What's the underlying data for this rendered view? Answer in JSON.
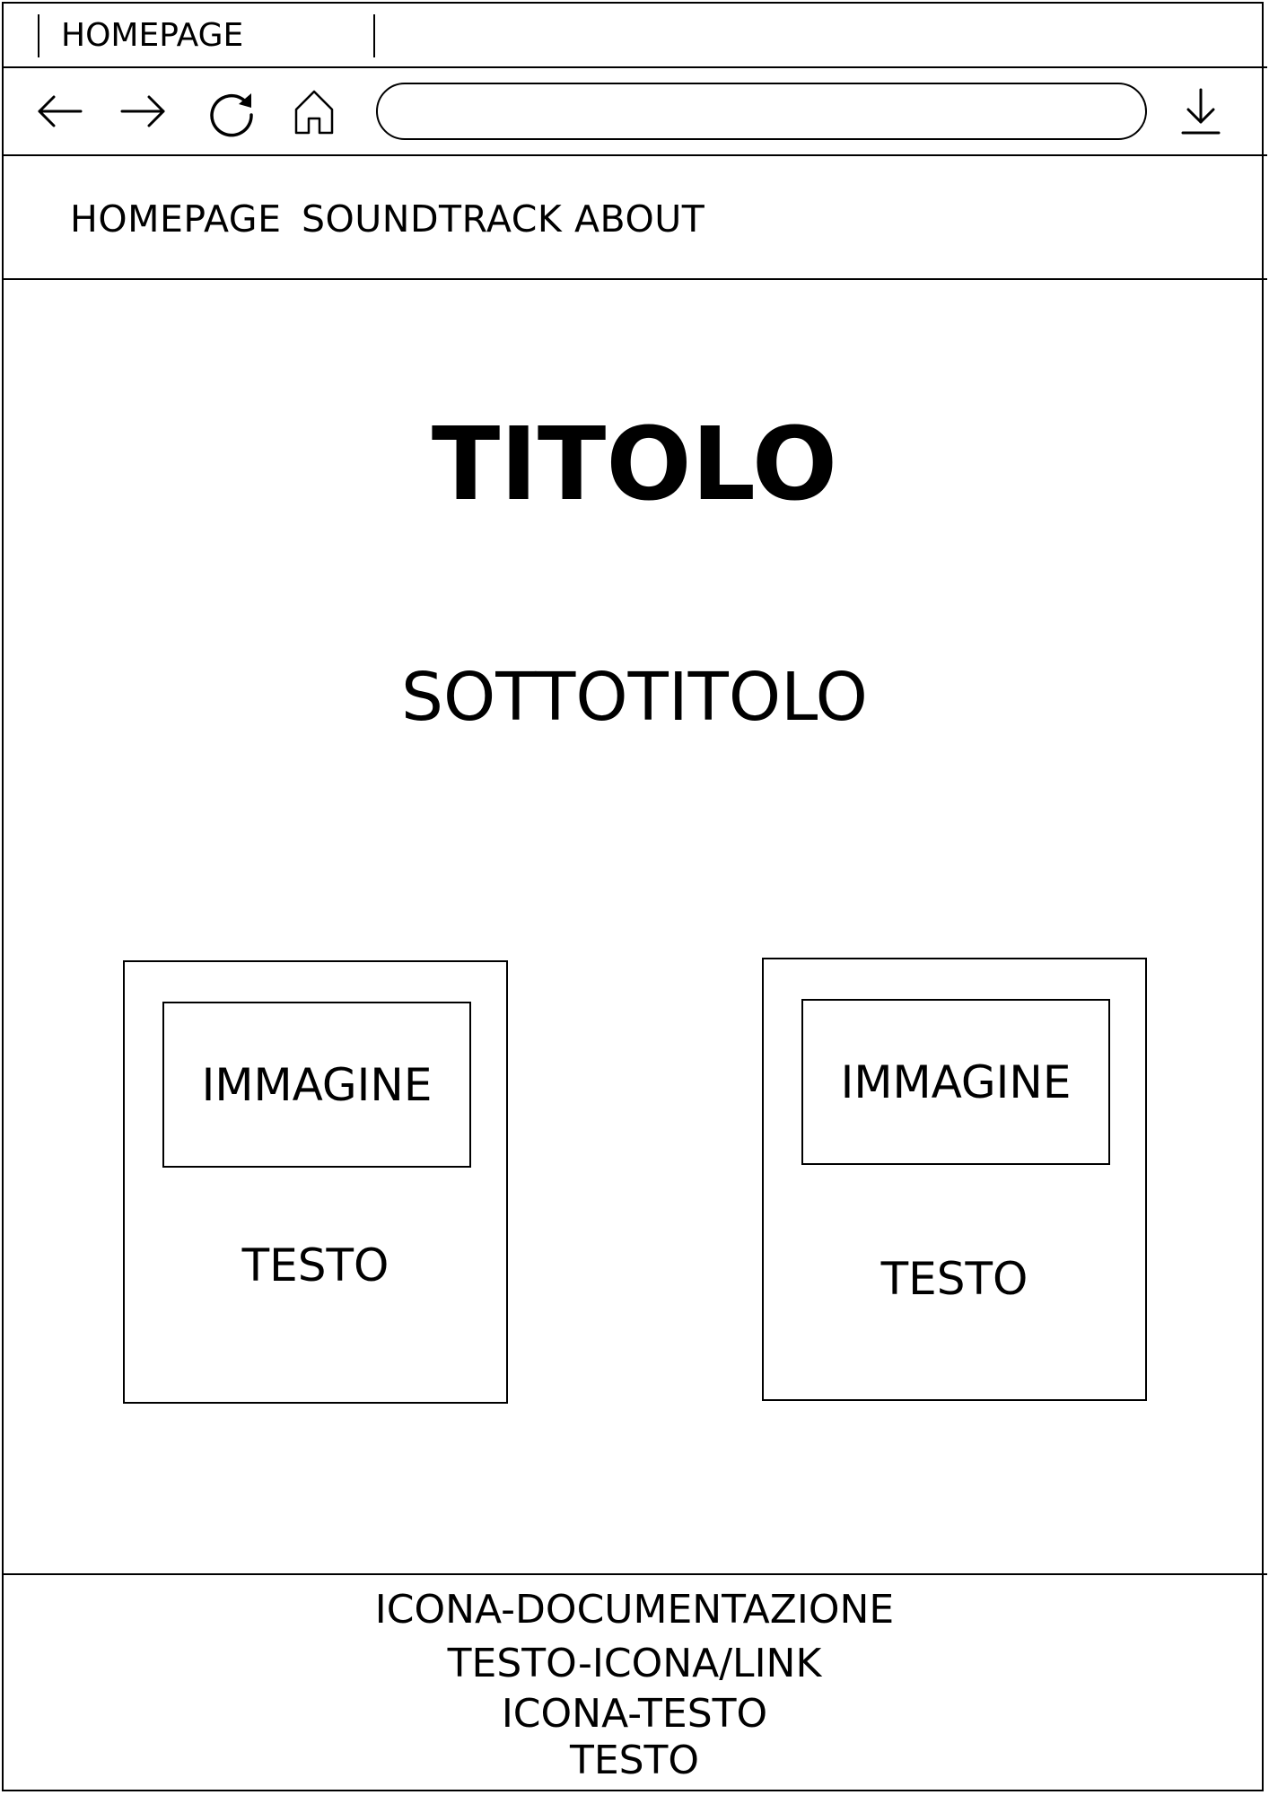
{
  "browser": {
    "tab": {
      "label": "HOMEPAGE"
    },
    "toolbar": {
      "icons": [
        "back-arrow-icon",
        "forward-arrow-icon",
        "reload-icon",
        "home-icon",
        "download-icon"
      ],
      "address_value": "",
      "address_placeholder": ""
    }
  },
  "nav": {
    "items": [
      {
        "label": "HOMEPAGE"
      },
      {
        "label": "SOUNDTRACK"
      },
      {
        "label": "ABOUT"
      }
    ]
  },
  "main": {
    "title": "TITOLO",
    "subtitle": "SOTTOTITOLO",
    "cards": [
      {
        "image_label": "IMMAGINE",
        "text": "TESTO"
      },
      {
        "image_label": "IMMAGINE",
        "text": "TESTO"
      }
    ]
  },
  "footer": {
    "lines": [
      "ICONA-DOCUMENTAZIONE",
      "TESTO-ICONA/LINK",
      "ICONA-TESTO",
      "TESTO"
    ]
  },
  "colors": {
    "line": "#000000",
    "background": "#ffffff"
  }
}
